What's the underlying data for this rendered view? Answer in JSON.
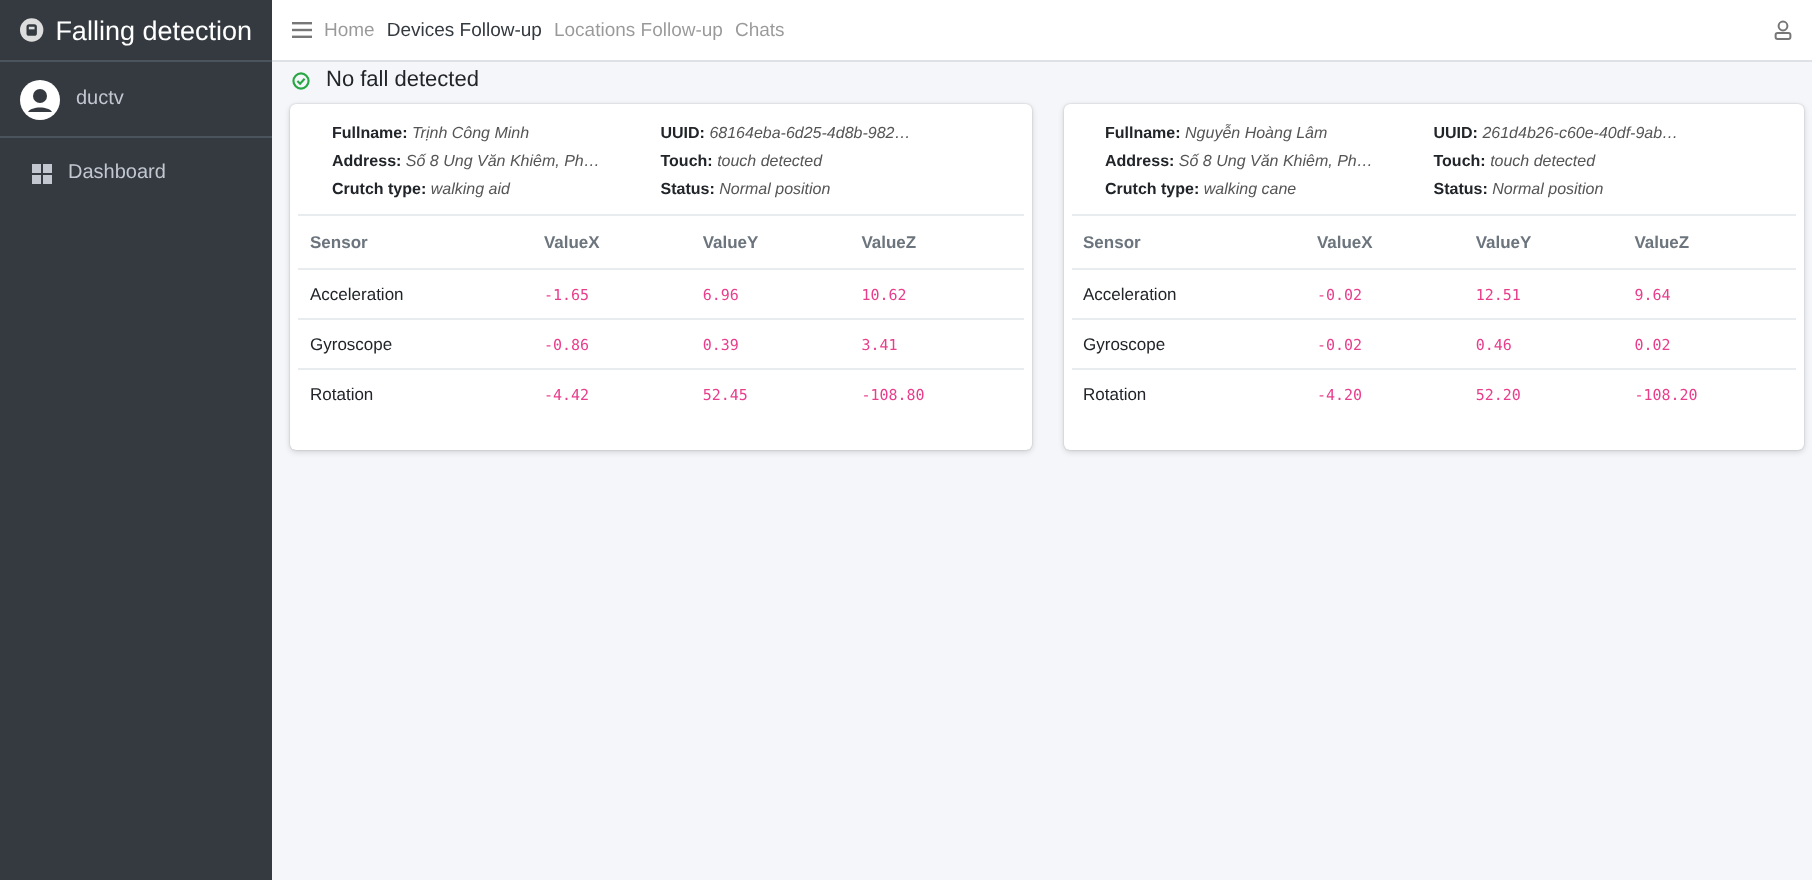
{
  "brand": {
    "title": "Falling detection"
  },
  "user": {
    "name": "ductv"
  },
  "sidebar": {
    "items": [
      {
        "label": "Dashboard",
        "selected": false
      }
    ]
  },
  "nav": {
    "items": [
      {
        "label": "Home",
        "selected": false
      },
      {
        "label": "Devices Follow-up",
        "selected": true
      },
      {
        "label": "Locations Follow-up",
        "selected": false
      },
      {
        "label": "Chats",
        "selected": false
      }
    ]
  },
  "status": {
    "text": "No fall detected"
  },
  "devices": [
    {
      "fields": [
        {
          "label": "Fullname:",
          "value": "Trịnh Công Minh"
        },
        {
          "label": "UUID:",
          "value": "68164eba-6d25-4d8b-982…"
        },
        {
          "label": "Address:",
          "value": "Số 8 Ung Văn Khiêm, Ph…"
        },
        {
          "label": "Touch:",
          "value": "touch detected"
        },
        {
          "label": "Crutch type:",
          "value": "walking aid"
        },
        {
          "label": "Status:",
          "value": "Normal position"
        }
      ],
      "columns": [
        "Sensor",
        "ValueX",
        "ValueY",
        "ValueZ"
      ],
      "rows": [
        [
          "Acceleration",
          "-1.65",
          "6.96",
          "10.62"
        ],
        [
          "Gyroscope",
          "-0.86",
          "0.39",
          "3.41"
        ],
        [
          "Rotation",
          "-4.42",
          "52.45",
          "-108.80"
        ]
      ]
    },
    {
      "fields": [
        {
          "label": "Fullname:",
          "value": "Nguyễn Hoàng Lâm"
        },
        {
          "label": "UUID:",
          "value": "261d4b26-c60e-40df-9ab…"
        },
        {
          "label": "Address:",
          "value": "Số 8 Ung Văn Khiêm, Ph…"
        },
        {
          "label": "Touch:",
          "value": "touch detected"
        },
        {
          "label": "Crutch type:",
          "value": "walking cane"
        },
        {
          "label": "Status:",
          "value": "Normal position"
        }
      ],
      "columns": [
        "Sensor",
        "ValueX",
        "ValueY",
        "ValueZ"
      ],
      "rows": [
        [
          "Acceleration",
          "-0.02",
          "12.51",
          "9.64"
        ],
        [
          "Gyroscope",
          "-0.02",
          "0.46",
          "0.02"
        ],
        [
          "Rotation",
          "-4.20",
          "52.20",
          "-108.20"
        ]
      ]
    }
  ]
}
